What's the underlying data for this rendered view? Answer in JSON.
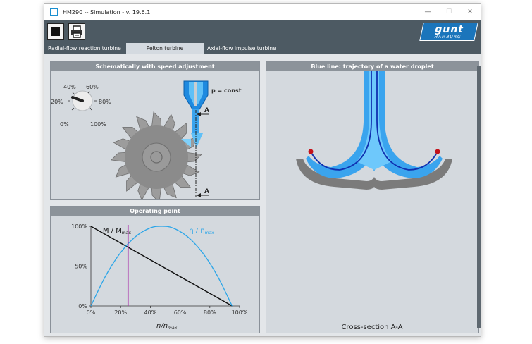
{
  "window": {
    "title": "HM290  --  Simulation - v. 19.6.1",
    "minimize": "—",
    "maximize": "☐",
    "close": "✕"
  },
  "toolbar": {
    "stop_icon": "stop-icon",
    "print_icon": "printer-icon"
  },
  "logo": {
    "main": "gunt",
    "sub": "HAMBURG"
  },
  "tabs": [
    {
      "label": "Radial-flow reaction turbine",
      "active": false
    },
    {
      "label": "Pelton turbine",
      "active": true
    },
    {
      "label": "Axial-flow impulse turbine",
      "active": false
    }
  ],
  "schematic": {
    "title": "Schematically with speed adjustment",
    "pressure_label": "p = const",
    "section_marker": "A",
    "speed_dial": {
      "labels": [
        "40%",
        "60%",
        "20%",
        "80%",
        "0%",
        "100%"
      ],
      "value_percent": 20
    }
  },
  "trajectory": {
    "title": "Blue line: trajectory of a water droplet",
    "caption": "Cross-section A-A"
  },
  "operating_point": {
    "title": "Operating point",
    "colors": {
      "torque": "#111111",
      "efficiency": "#2aa5e8",
      "marker": "#aa33aa"
    }
  },
  "chart_data": {
    "type": "line",
    "title": "Operating point",
    "xlabel": "n/nmax",
    "xlabel_main": "n/n",
    "xlabel_sub": "max",
    "ylabel": "",
    "x_ticks": [
      "0%",
      "20%",
      "40%",
      "60%",
      "80%",
      "100%"
    ],
    "y_ticks": [
      "0%",
      "50%",
      "100%"
    ],
    "xlim": [
      0,
      100
    ],
    "ylim": [
      0,
      100
    ],
    "grid": false,
    "series": [
      {
        "name": "M / Mmax",
        "label_main": "M / M",
        "label_sub": "max",
        "color": "#111111",
        "x": [
          0,
          95
        ],
        "y": [
          100,
          0
        ]
      },
      {
        "name": "η / ηmax",
        "label_main": "η / η",
        "label_sub": "max",
        "color": "#2aa5e8",
        "x": [
          0,
          10,
          20,
          30,
          40,
          47.5,
          55,
          65,
          75,
          85,
          95
        ],
        "y": [
          0,
          38,
          67,
          87,
          98,
          100,
          98,
          87,
          67,
          38,
          0
        ]
      }
    ],
    "operating_point_x": 25
  }
}
